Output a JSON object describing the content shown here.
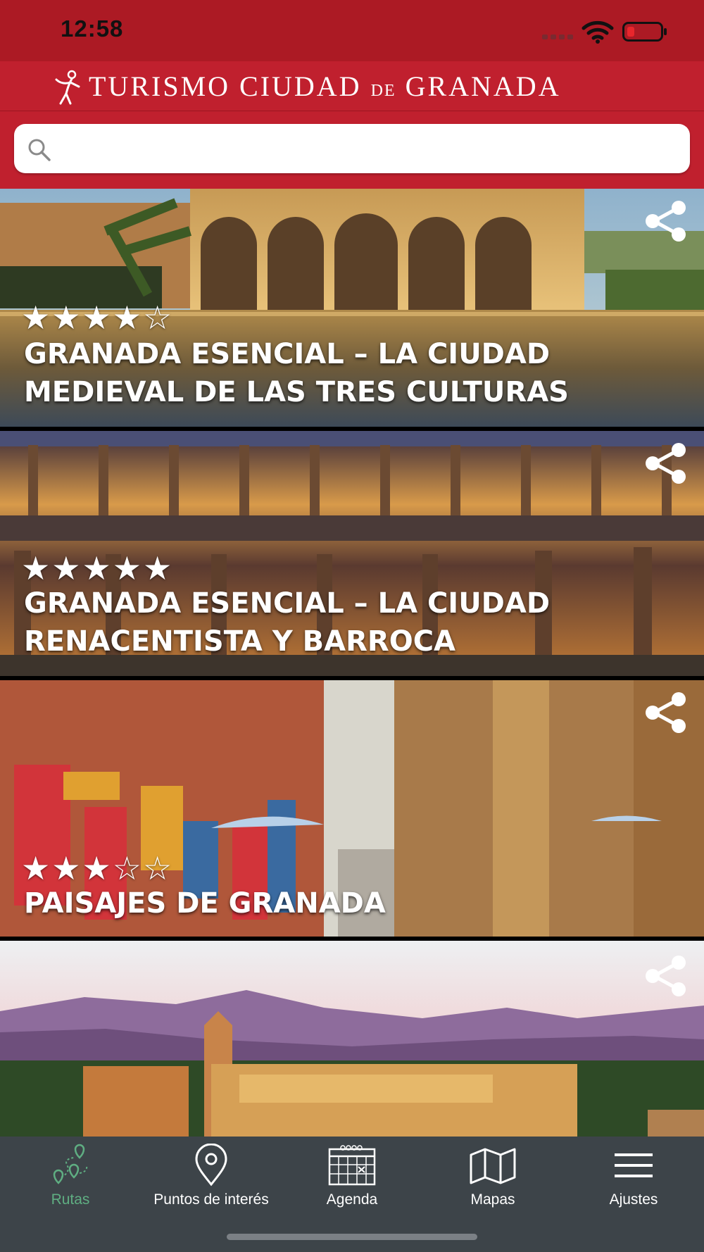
{
  "status_bar": {
    "time": "12:58"
  },
  "header": {
    "title_part1": "TURISMO CIUDAD ",
    "title_small": "DE",
    "title_part2": " GRANADA",
    "logo_icon": "dancer-logo-icon"
  },
  "search": {
    "placeholder": "",
    "value": ""
  },
  "routes": [
    {
      "title": "GRANADA ESENCIAL – LA CIUDAD MEDIEVAL DE LAS TRES CULTURAS",
      "rating": 4,
      "max_rating": 5,
      "stars_text": "★★★★☆"
    },
    {
      "title": "GRANADA ESENCIAL – LA CIUDAD RENACENTISTA Y BARROCA",
      "rating": 5,
      "max_rating": 5,
      "stars_text": "★★★★★"
    },
    {
      "title": "PAISAJES DE GRANADA",
      "rating": 3,
      "max_rating": 5,
      "stars_text": "★★★☆☆"
    },
    {
      "title": "",
      "rating": null,
      "max_rating": 5,
      "stars_text": ""
    }
  ],
  "tabs": [
    {
      "label": "Rutas",
      "icon": "route-pins-icon",
      "active": true
    },
    {
      "label": "Puntos de interés",
      "icon": "map-pin-icon",
      "active": false
    },
    {
      "label": "Agenda",
      "icon": "calendar-icon",
      "active": false
    },
    {
      "label": "Mapas",
      "icon": "folded-map-icon",
      "active": false
    },
    {
      "label": "Ajustes",
      "icon": "menu-icon",
      "active": false
    }
  ],
  "colors": {
    "brand_red": "#c0202e",
    "status_red": "#ac1a24",
    "tab_bar": "#3d4449",
    "active_tab": "#5fae82"
  }
}
